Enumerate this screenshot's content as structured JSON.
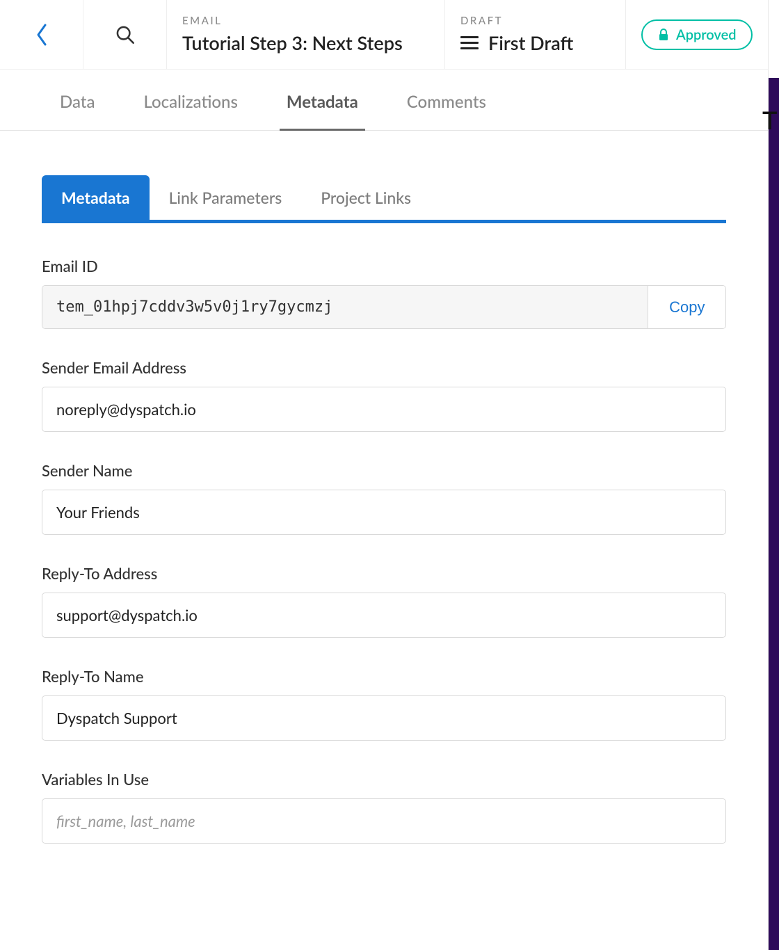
{
  "topbar": {
    "email_eyebrow": "EMAIL",
    "title": "Tutorial Step 3: Next Steps",
    "draft_eyebrow": "DRAFT",
    "draft_name": "First Draft",
    "approve_label": "Approved"
  },
  "primary_tabs": {
    "data": "Data",
    "localizations": "Localizations",
    "metadata": "Metadata",
    "comments": "Comments"
  },
  "sub_tabs": {
    "metadata": "Metadata",
    "link_parameters": "Link Parameters",
    "project_links": "Project Links"
  },
  "fields": {
    "email_id_label": "Email ID",
    "email_id_value": "tem_01hpj7cddv3w5v0j1ry7gycmzj",
    "copy_label": "Copy",
    "sender_email_label": "Sender Email Address",
    "sender_email_value": "noreply@dyspatch.io",
    "sender_name_label": "Sender Name",
    "sender_name_value": "Your Friends",
    "reply_to_address_label": "Reply-To Address",
    "reply_to_address_value": "support@dyspatch.io",
    "reply_to_name_label": "Reply-To Name",
    "reply_to_name_value": "Dyspatch Support",
    "variables_label": "Variables In Use",
    "variables_placeholder": "first_name, last_name"
  },
  "misc": {
    "right_char": "T"
  }
}
